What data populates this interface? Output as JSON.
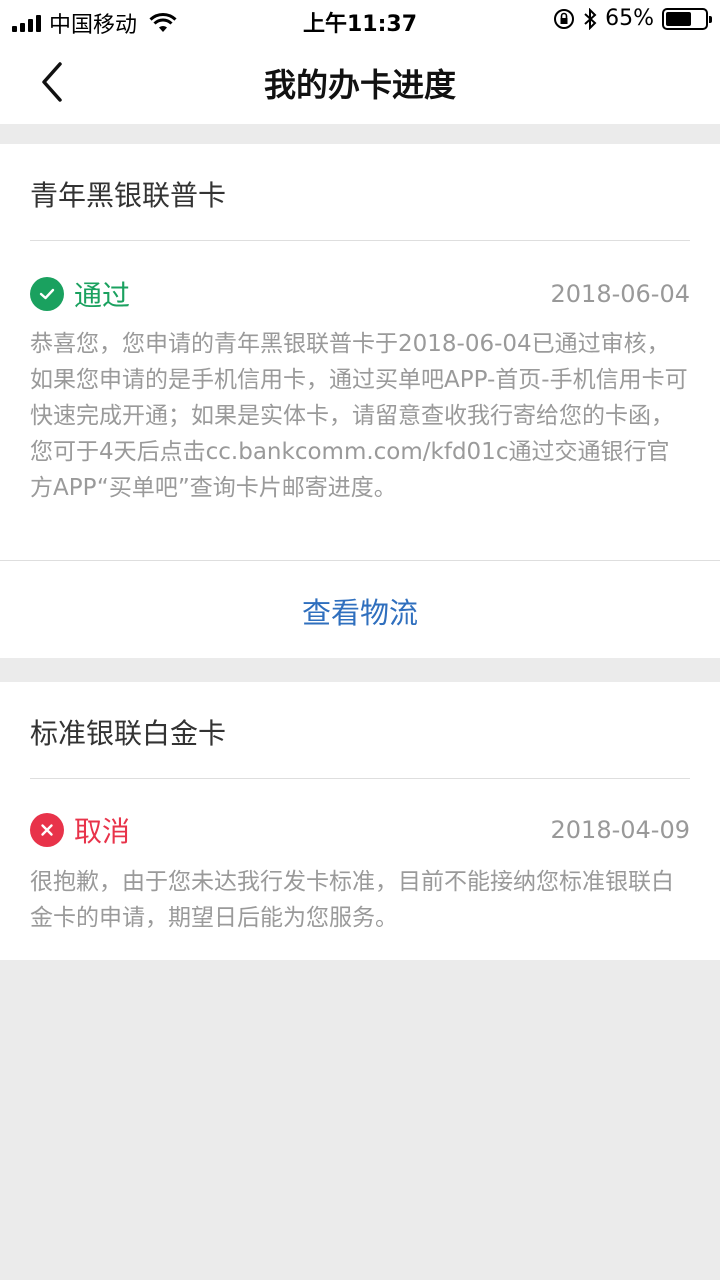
{
  "status_bar": {
    "carrier": "中国移动",
    "time": "上午11:37",
    "battery": "65%",
    "battery_level": 0.65
  },
  "nav": {
    "title": "我的办卡进度"
  },
  "cards": [
    {
      "name": "青年黑银联普卡",
      "status": "通过",
      "status_color": "#1aa15f",
      "status_icon": "check-icon",
      "date": "2018-06-04",
      "description": "恭喜您，您申请的青年黑银联普卡于2018-06-04已通过审核，如果您申请的是手机信用卡，通过买单吧APP-首页-手机信用卡可快速完成开通；如果是实体卡，请留意查收我行寄给您的卡函，您可于4天后点击cc.bankcomm.com/kfd01c通过交通银行官方APP“买单吧”查询卡片邮寄进度。",
      "action": "查看物流"
    },
    {
      "name": "标准银联白金卡",
      "status": "取消",
      "status_color": "#e8334a",
      "status_icon": "cross-icon",
      "date": "2018-04-09",
      "description": "很抱歉，由于您未达我行发卡标准，目前不能接纳您标准银联白金卡的申请，期望日后能为您服务。"
    }
  ],
  "colors": {
    "link": "#2f6fbe",
    "background": "#ebebeb"
  }
}
